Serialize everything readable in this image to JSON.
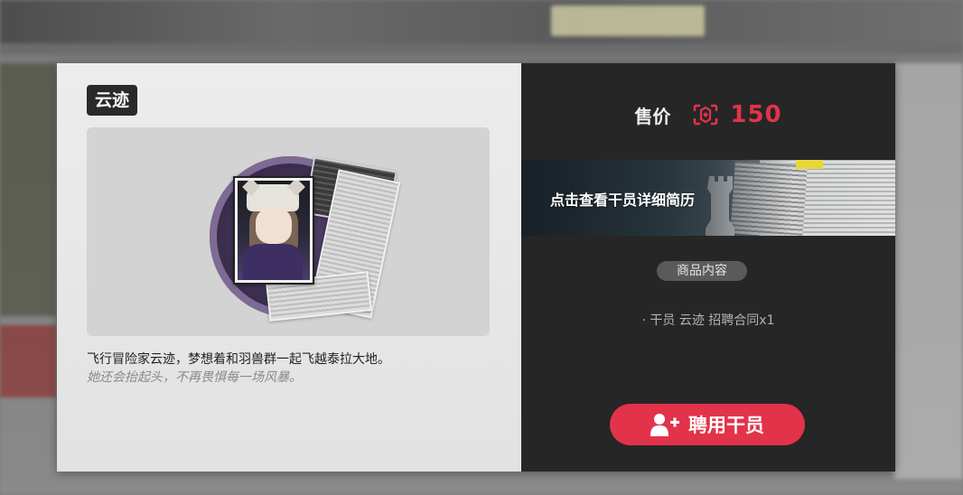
{
  "item": {
    "name": "云迹",
    "description_line1": "飞行冒险家云迹，梦想着和羽兽群一起飞越泰拉大地。",
    "description_line2": "她还会抬起头，不再畏惧每一场风暴。"
  },
  "price": {
    "label": "售价",
    "icon": "credit-token-icon",
    "value": "150",
    "color": "#e2334a"
  },
  "banner": {
    "text": "点击查看干员详细简历"
  },
  "contents": {
    "badge_label": "商品内容",
    "items": [
      "· 干员 云迹 招聘合同x1"
    ]
  },
  "hire_button": {
    "label": "聘用干员",
    "icon": "add-user-icon",
    "color": "#e2334a"
  },
  "colors": {
    "accent": "#e2334a",
    "dark_pane": "#262626",
    "light_pane": "#e6e6e6"
  }
}
